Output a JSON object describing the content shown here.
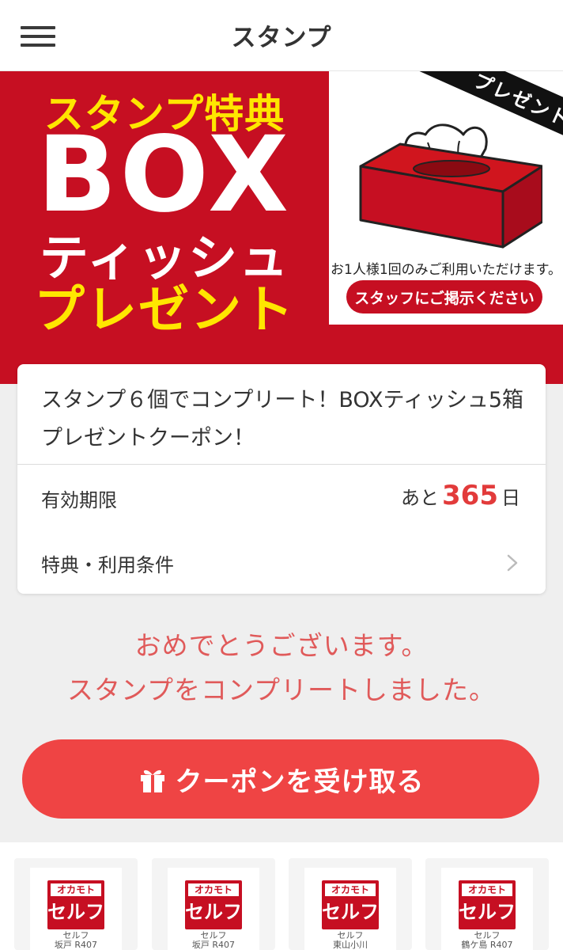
{
  "header": {
    "title": "スタンプ"
  },
  "banner": {
    "line1": "スタンプ特典",
    "line2": "BOX",
    "line3": "ティッシュ",
    "line4": "プレゼント",
    "ribbon": "プレゼント",
    "note": "お1人様1回のみご利用いただけます。",
    "staff_pill": "スタッフにご掲示ください"
  },
  "coupon_card": {
    "title": "スタンプ６個でコンプリート！BOXティッシュ5箱プレゼントクーポン！",
    "validity_label": "有効期限",
    "validity_prefix": "あと",
    "validity_days": "365",
    "validity_suffix": "日",
    "terms_label": "特典・利用条件"
  },
  "congrats": {
    "line1": "おめでとうございます。",
    "line2": "スタンプをコンプリートしました。"
  },
  "coupon_button": {
    "label": "クーポンを受け取る"
  },
  "stamps": [
    {
      "logo_top": "オカモト",
      "logo_bottom": "セルフ",
      "caption_1": "セルフ",
      "caption_2": "坂戸 R407"
    },
    {
      "logo_top": "オカモト",
      "logo_bottom": "セルフ",
      "caption_1": "セルフ",
      "caption_2": "坂戸 R407"
    },
    {
      "logo_top": "オカモト",
      "logo_bottom": "セルフ",
      "caption_1": "セルフ",
      "caption_2": "東山小川"
    },
    {
      "logo_top": "オカモト",
      "logo_bottom": "セルフ",
      "caption_1": "セルフ",
      "caption_2": "鶴ケ島 R407"
    }
  ],
  "colors": {
    "brand_red": "#c60f22",
    "accent_red": "#ef4444",
    "banner_yellow": "#ffe600",
    "congrats_text": "#e05a5a"
  }
}
